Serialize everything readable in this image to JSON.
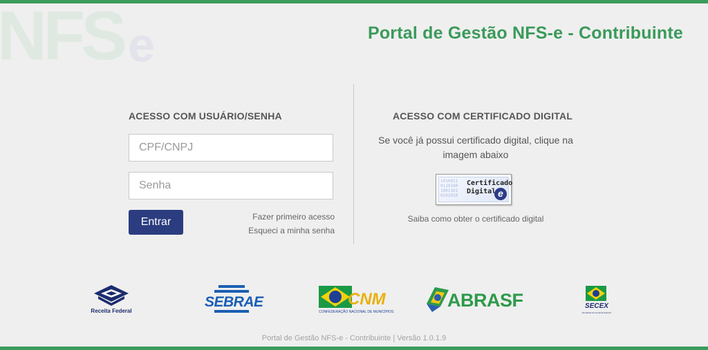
{
  "header": {
    "title": "Portal de Gestão NFS-e - Contribuinte",
    "watermark_main": "NFS",
    "watermark_e": "e"
  },
  "login": {
    "section_title": "ACESSO COM USUÁRIO/SENHA",
    "cpf_placeholder": "CPF/CNPJ",
    "cpf_value": "",
    "password_placeholder": "Senha",
    "password_value": "",
    "submit_label": "Entrar",
    "first_access_link": "Fazer primeiro acesso",
    "forgot_password_link": "Esqueci a minha senha"
  },
  "certificate": {
    "section_title": "ACESSO COM CERTIFICADO DIGITAL",
    "description": "Se você já possui certificado digital, clique na imagem abaixo",
    "image_line1": "Certificado",
    "image_line2": "Digital",
    "image_badge": "e",
    "help_link": "Saiba como obter o certificado digital"
  },
  "partners": [
    {
      "name": "Receita Federal",
      "icon": "receita-federal-logo"
    },
    {
      "name": "SEBRAE",
      "icon": "sebrae-logo"
    },
    {
      "name": "CNM",
      "caption": "CONFEDERAÇÃO NACIONAL DE MUNICÍPIOS",
      "icon": "cnm-logo"
    },
    {
      "name": "ABRASF",
      "icon": "abrasf-logo"
    },
    {
      "name": "SECEX",
      "caption": "Secretaria de Comércio Exterior",
      "icon": "secex-logo"
    }
  ],
  "footer": {
    "text": "Portal de Gestão NFS-e - Contribuinte | Versão 1.0.1.9"
  },
  "colors": {
    "brand_green": "#3c9c5c",
    "button_blue": "#2b3d80",
    "background": "#efefef"
  }
}
